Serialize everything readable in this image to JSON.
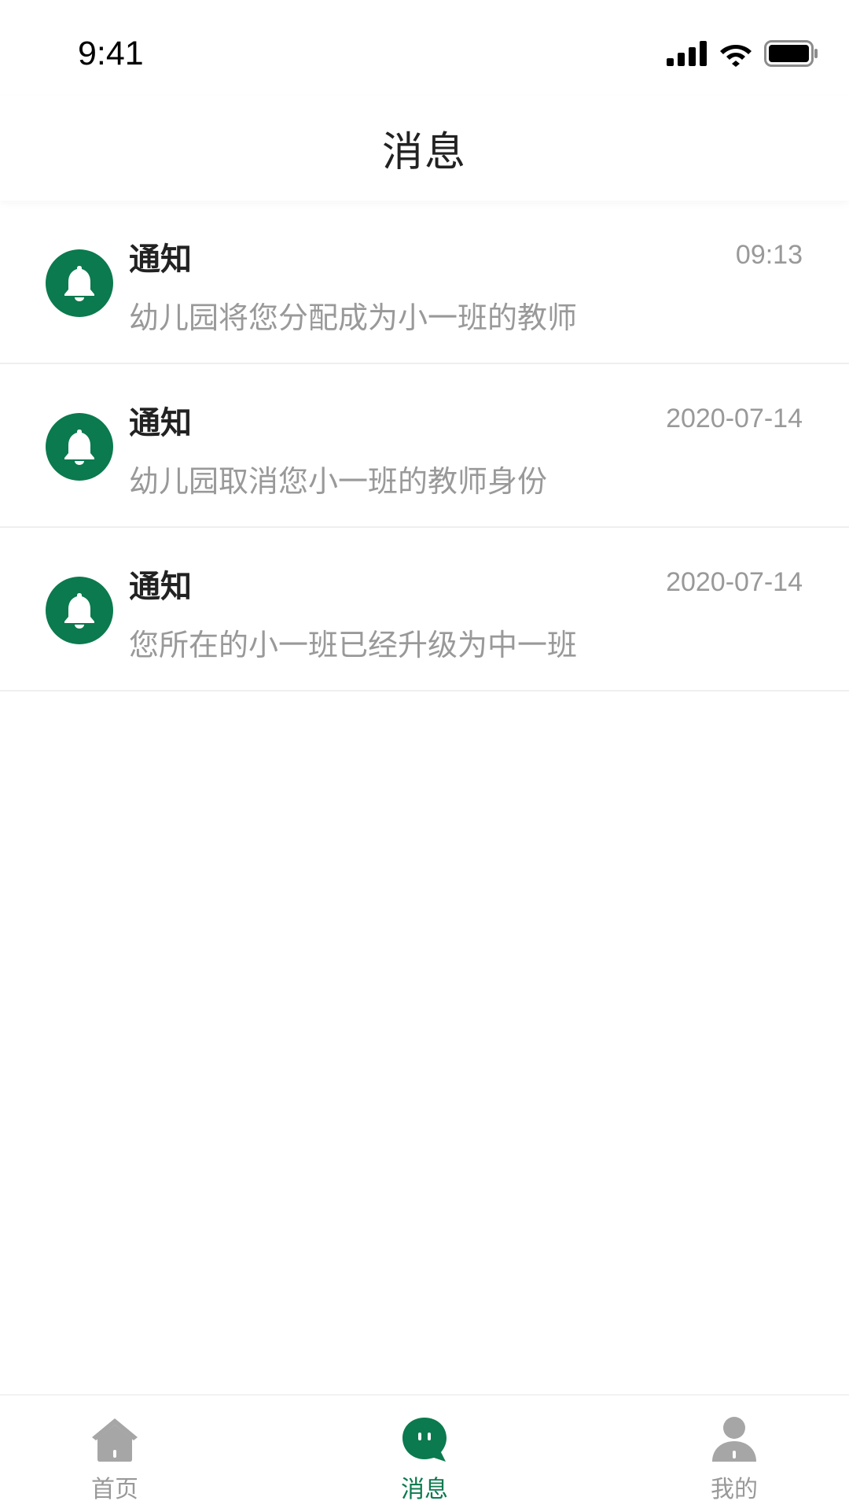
{
  "status_bar": {
    "time": "9:41"
  },
  "header": {
    "title": "消息"
  },
  "messages": [
    {
      "title": "通知",
      "time": "09:13",
      "content": "幼儿园将您分配成为小一班的教师"
    },
    {
      "title": "通知",
      "time": "2020-07-14",
      "content": "幼儿园取消您小一班的教师身份"
    },
    {
      "title": "通知",
      "time": "2020-07-14",
      "content": "您所在的小一班已经升级为中一班"
    }
  ],
  "tabbar": {
    "home_label": "首页",
    "messages_label": "消息",
    "mine_label": "我的",
    "active": "messages"
  },
  "colors": {
    "accent": "#0b7a4e",
    "muted": "#999999",
    "inactive_icon": "#a6a6a6"
  },
  "icons": {
    "message": "bell-icon",
    "home": "home-icon",
    "messages_tab": "chat-bubble-icon",
    "mine": "person-icon"
  }
}
